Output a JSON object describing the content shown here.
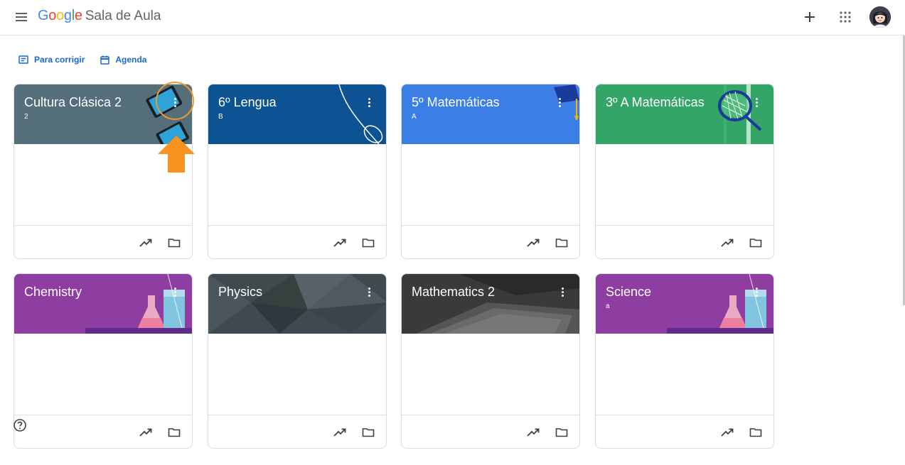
{
  "app": {
    "logo_letters": [
      "G",
      "o",
      "o",
      "g",
      "l",
      "e"
    ],
    "product": "Sala de Aula"
  },
  "top_actions": {
    "create_icon": "plus-icon",
    "apps_icon": "apps-grid-icon",
    "account_icon": "avatar"
  },
  "subnav": {
    "to_review": "Para corrigir",
    "calendar": "Agenda"
  },
  "classes": [
    {
      "title": "Cultura Clásica 2",
      "section": "2",
      "color": "#546e7a",
      "theme": "tablets"
    },
    {
      "title": "6º Lengua",
      "section": "B",
      "color": "#0d5394",
      "theme": "lines"
    },
    {
      "title": "5º Matemáticas",
      "section": "A",
      "color": "#3b7fe6",
      "theme": "graduation"
    },
    {
      "title": "3º A Matemáticas",
      "section": "",
      "color": "#33a566",
      "theme": "tennis"
    },
    {
      "title": "Chemistry",
      "section": "",
      "color": "#8e3ea0",
      "theme": "flask"
    },
    {
      "title": "Physics",
      "section": "",
      "color": "#3f4a4f",
      "theme": "texture"
    },
    {
      "title": "Mathematics 2",
      "section": "",
      "color": "#3a3a3a",
      "theme": "book"
    },
    {
      "title": "Science",
      "section": "a",
      "color": "#8e3ea0",
      "theme": "flask"
    }
  ],
  "card_actions": {
    "progress_icon": "trending-up-icon",
    "folder_icon": "folder-icon",
    "more_icon": "more-vert-icon"
  },
  "help_icon": "help-icon"
}
